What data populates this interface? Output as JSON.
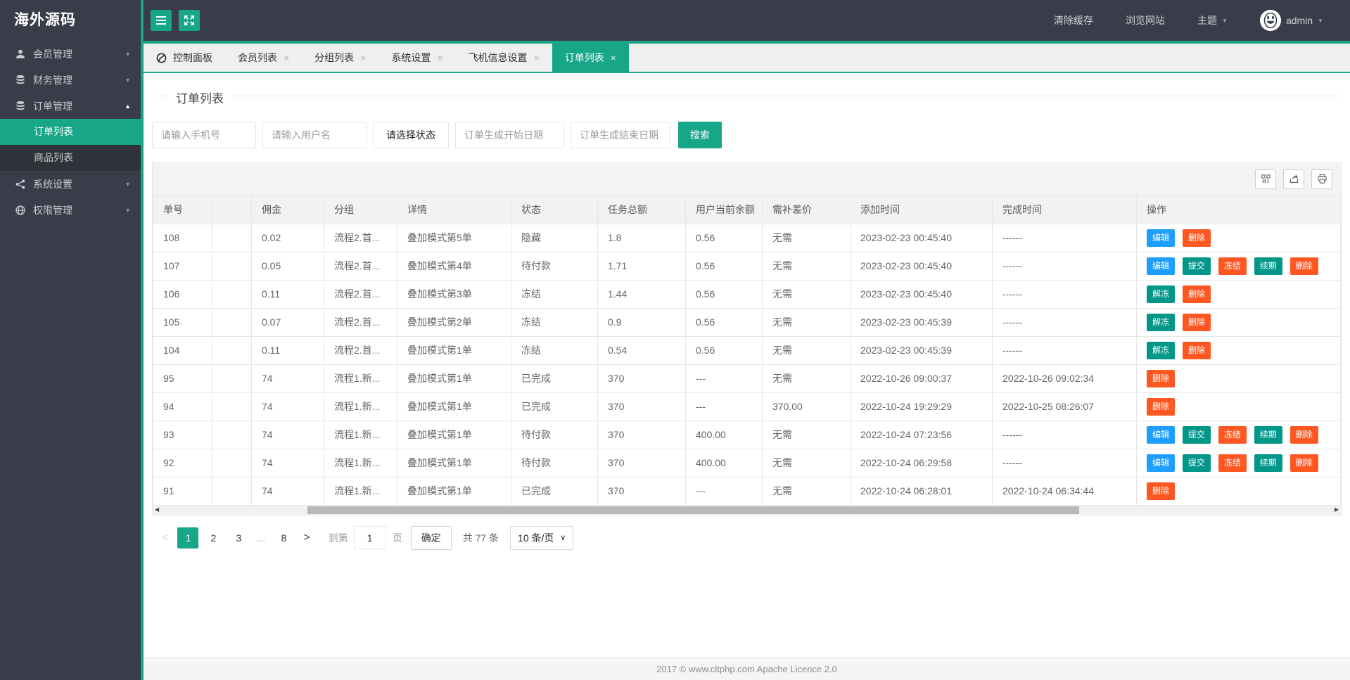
{
  "colors": {
    "accent_teal": "#18A689",
    "button_teal": "#009688",
    "button_blue": "#1E9FFF",
    "button_orange": "#FF5722",
    "sidebar_bg": "#393D49"
  },
  "sidebar": {
    "logo": "海外源码",
    "menu": [
      {
        "label": "会员管理",
        "icon": "user-icon",
        "expanded": false
      },
      {
        "label": "财务管理",
        "icon": "finance-icon",
        "expanded": false
      },
      {
        "label": "订单管理",
        "icon": "order-icon",
        "expanded": true,
        "children": [
          {
            "label": "订单列表",
            "active": true
          },
          {
            "label": "商品列表",
            "active": false
          }
        ]
      },
      {
        "label": "系统设置",
        "icon": "settings-icon",
        "expanded": false
      },
      {
        "label": "权限管理",
        "icon": "permission-icon",
        "expanded": false
      }
    ]
  },
  "topbar": {
    "clear_cache": "清除缓存",
    "browse_site": "浏览网站",
    "theme": "主题",
    "username": "admin"
  },
  "tabs": [
    {
      "label": "控制面板",
      "closable": false,
      "active": false
    },
    {
      "label": "会员列表",
      "closable": true,
      "active": false
    },
    {
      "label": "分组列表",
      "closable": true,
      "active": false
    },
    {
      "label": "系统设置",
      "closable": true,
      "active": false
    },
    {
      "label": "飞机信息设置",
      "closable": true,
      "active": false
    },
    {
      "label": "订单列表",
      "closable": true,
      "active": true
    }
  ],
  "page": {
    "title": "订单列表"
  },
  "search": {
    "phone_placeholder": "请输入手机号",
    "username_placeholder": "请输入用户名",
    "status_label": "请选择状态",
    "start_date_placeholder": "订单生成开始日期",
    "end_date_placeholder": "订单生成结束日期",
    "search_button": "搜索"
  },
  "table": {
    "close_glyph": "×",
    "columns": [
      "单号",
      "",
      "佣金",
      "分组",
      "详情",
      "状态",
      "任务总额",
      "用户当前余额",
      "需补差价",
      "添加时间",
      "完成时间",
      "操作"
    ],
    "rows": [
      {
        "id": "108",
        "commission": "0.02",
        "group": "流程2.首...",
        "detail": "叠加模式第5单",
        "status": "隐藏",
        "total": "1.8",
        "balance": "0.56",
        "diff": "无需",
        "created": "2023-02-23 00:45:40",
        "finished": "------",
        "actions": [
          {
            "label": "编辑",
            "type": "blue"
          },
          {
            "label": "删除",
            "type": "orange"
          }
        ]
      },
      {
        "id": "107",
        "commission": "0.05",
        "group": "流程2.首...",
        "detail": "叠加模式第4单",
        "status": "待付款",
        "total": "1.71",
        "balance": "0.56",
        "diff": "无需",
        "created": "2023-02-23 00:45:40",
        "finished": "------",
        "actions": [
          {
            "label": "编辑",
            "type": "blue"
          },
          {
            "label": "提交",
            "type": "teal"
          },
          {
            "label": "冻结",
            "type": "orange"
          },
          {
            "label": "续期",
            "type": "teal"
          },
          {
            "label": "删除",
            "type": "orange"
          }
        ]
      },
      {
        "id": "106",
        "commission": "0.11",
        "group": "流程2.首...",
        "detail": "叠加模式第3单",
        "status": "冻结",
        "total": "1.44",
        "balance": "0.56",
        "diff": "无需",
        "created": "2023-02-23 00:45:40",
        "finished": "------",
        "actions": [
          {
            "label": "解冻",
            "type": "teal"
          },
          {
            "label": "删除",
            "type": "orange"
          }
        ]
      },
      {
        "id": "105",
        "commission": "0.07",
        "group": "流程2.首...",
        "detail": "叠加模式第2单",
        "status": "冻结",
        "total": "0.9",
        "balance": "0.56",
        "diff": "无需",
        "created": "2023-02-23 00:45:39",
        "finished": "------",
        "actions": [
          {
            "label": "解冻",
            "type": "teal"
          },
          {
            "label": "删除",
            "type": "orange"
          }
        ]
      },
      {
        "id": "104",
        "commission": "0.11",
        "group": "流程2.首...",
        "detail": "叠加模式第1单",
        "status": "冻结",
        "total": "0.54",
        "balance": "0.56",
        "diff": "无需",
        "created": "2023-02-23 00:45:39",
        "finished": "------",
        "actions": [
          {
            "label": "解冻",
            "type": "teal"
          },
          {
            "label": "删除",
            "type": "orange"
          }
        ]
      },
      {
        "id": "95",
        "commission": "74",
        "group": "流程1.新...",
        "detail": "叠加模式第1单",
        "status": "已完成",
        "total": "370",
        "balance": "---",
        "diff": "无需",
        "created": "2022-10-26 09:00:37",
        "finished": "2022-10-26 09:02:34",
        "actions": [
          {
            "label": "删除",
            "type": "orange"
          }
        ]
      },
      {
        "id": "94",
        "commission": "74",
        "group": "流程1.新...",
        "detail": "叠加模式第1单",
        "status": "已完成",
        "total": "370",
        "balance": "---",
        "diff": "370.00",
        "created": "2022-10-24 19:29:29",
        "finished": "2022-10-25 08:26:07",
        "actions": [
          {
            "label": "删除",
            "type": "orange"
          }
        ]
      },
      {
        "id": "93",
        "commission": "74",
        "group": "流程1.新...",
        "detail": "叠加模式第1单",
        "status": "待付款",
        "total": "370",
        "balance": "400.00",
        "diff": "无需",
        "created": "2022-10-24 07:23:56",
        "finished": "------",
        "actions": [
          {
            "label": "编辑",
            "type": "blue"
          },
          {
            "label": "提交",
            "type": "teal"
          },
          {
            "label": "冻结",
            "type": "orange"
          },
          {
            "label": "续期",
            "type": "teal"
          },
          {
            "label": "删除",
            "type": "orange"
          }
        ]
      },
      {
        "id": "92",
        "commission": "74",
        "group": "流程1.新...",
        "detail": "叠加模式第1单",
        "status": "待付款",
        "total": "370",
        "balance": "400.00",
        "diff": "无需",
        "created": "2022-10-24 06:29:58",
        "finished": "------",
        "actions": [
          {
            "label": "编辑",
            "type": "blue"
          },
          {
            "label": "提交",
            "type": "teal"
          },
          {
            "label": "冻结",
            "type": "orange"
          },
          {
            "label": "续期",
            "type": "teal"
          },
          {
            "label": "删除",
            "type": "orange"
          }
        ]
      },
      {
        "id": "91",
        "commission": "74",
        "group": "流程1.新...",
        "detail": "叠加模式第1单",
        "status": "已完成",
        "total": "370",
        "balance": "---",
        "diff": "无需",
        "created": "2022-10-24 06:28:01",
        "finished": "2022-10-24 06:34:44",
        "actions": [
          {
            "label": "删除",
            "type": "orange"
          }
        ]
      }
    ]
  },
  "scrollbar": {
    "thumb_left_percent": 13,
    "thumb_width_percent": 65
  },
  "pagination": {
    "prev": "<",
    "pages": [
      {
        "label": "1",
        "active": true
      },
      {
        "label": "2",
        "active": false
      },
      {
        "label": "3",
        "active": false
      },
      {
        "label": "...",
        "ellipsis": true
      },
      {
        "label": "8",
        "active": false
      }
    ],
    "next": ">",
    "goto_label": "到第",
    "goto_value": "1",
    "page_unit": "页",
    "confirm": "确定",
    "total": "共 77 条",
    "per_page": "10 条/页"
  },
  "footer": {
    "text": "2017 ©  www.cltphp.com  Apache Licence 2.0"
  }
}
